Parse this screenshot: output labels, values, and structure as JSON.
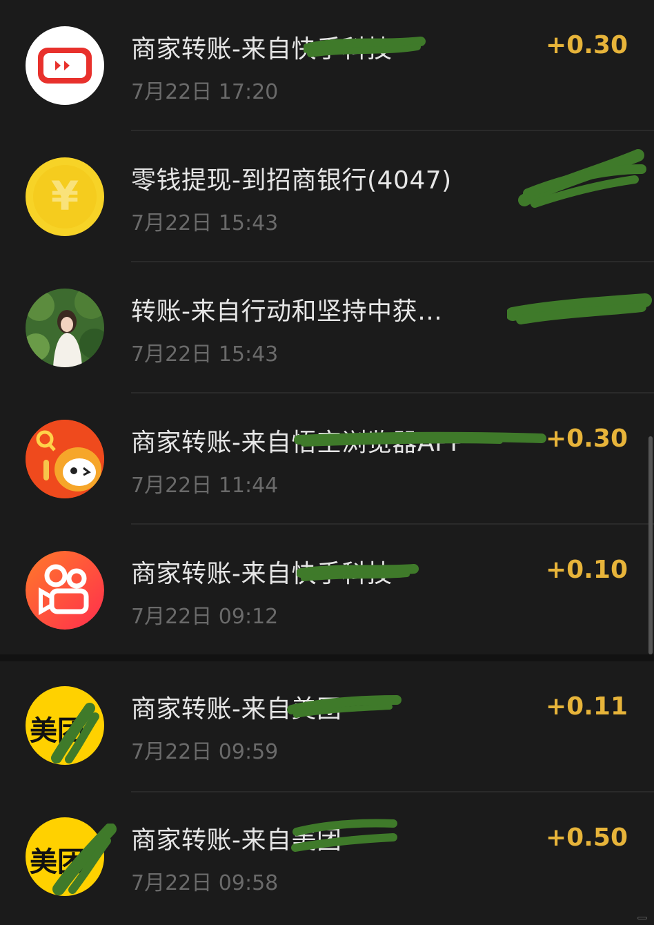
{
  "transactions": [
    {
      "title": "商家转账-来自快手科技",
      "time": "7月22日 17:20",
      "amount": "+0.30",
      "icon": "kuaishou-app-icon"
    },
    {
      "title": "零钱提现-到招商银行(4047)",
      "time": "7月22日 15:43",
      "amount": "",
      "icon": "yuan-coin-icon"
    },
    {
      "title": "转账-来自行动和坚持中获…",
      "time": "7月22日 15:43",
      "amount": "",
      "icon": "user-photo-avatar"
    },
    {
      "title": "商家转账-来自悟空浏览器APP",
      "time": "7月22日 11:44",
      "amount": "+0.30",
      "icon": "wukong-browser-icon"
    },
    {
      "title": "商家转账-来自快手科技",
      "time": "7月22日 09:12",
      "amount": "+0.10",
      "icon": "kuaishou-camera-icon"
    },
    {
      "title": "商家转账-来自美团",
      "time": "7月22日 09:59",
      "amount": "+0.11",
      "icon": "meituan-icon"
    },
    {
      "title": "商家转账-来自美团",
      "time": "7月22日 09:58",
      "amount": "+0.50",
      "icon": "meituan-icon"
    }
  ],
  "icons": {
    "meituan_label": "美团",
    "yuan_symbol": "¥"
  },
  "colors": {
    "amount": "#e7b43a",
    "redaction": "#3f7a2a",
    "background": "#1b1b1b"
  }
}
